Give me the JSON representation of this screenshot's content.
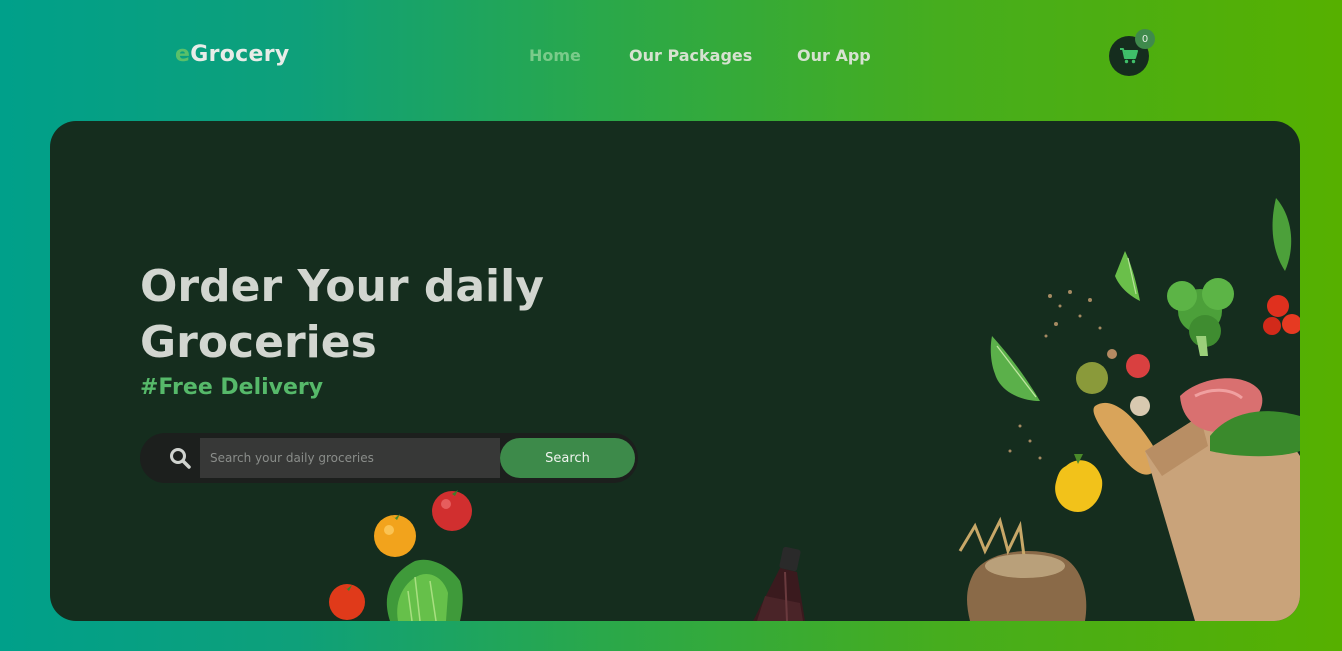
{
  "header": {
    "brand_prefix": "e",
    "brand_rest": "Grocery",
    "nav": [
      {
        "label": "Home",
        "active": true
      },
      {
        "label": "Our Packages",
        "active": false
      },
      {
        "label": "Our App",
        "active": false
      }
    ],
    "cart_count": "0",
    "cart_icon": "shopping-cart-icon"
  },
  "hero": {
    "title": "Order Your daily Groceries",
    "tagline": "#Free Delivery",
    "search": {
      "placeholder": "Search your daily groceries",
      "value": "",
      "button_label": "Search",
      "icon": "search-icon"
    }
  },
  "colors": {
    "gradient_start": "#00a08a",
    "gradient_end": "#56b000",
    "hero_bg": "#152d1e",
    "accent_green": "#56b96a",
    "button_green": "#3d8a4a"
  }
}
